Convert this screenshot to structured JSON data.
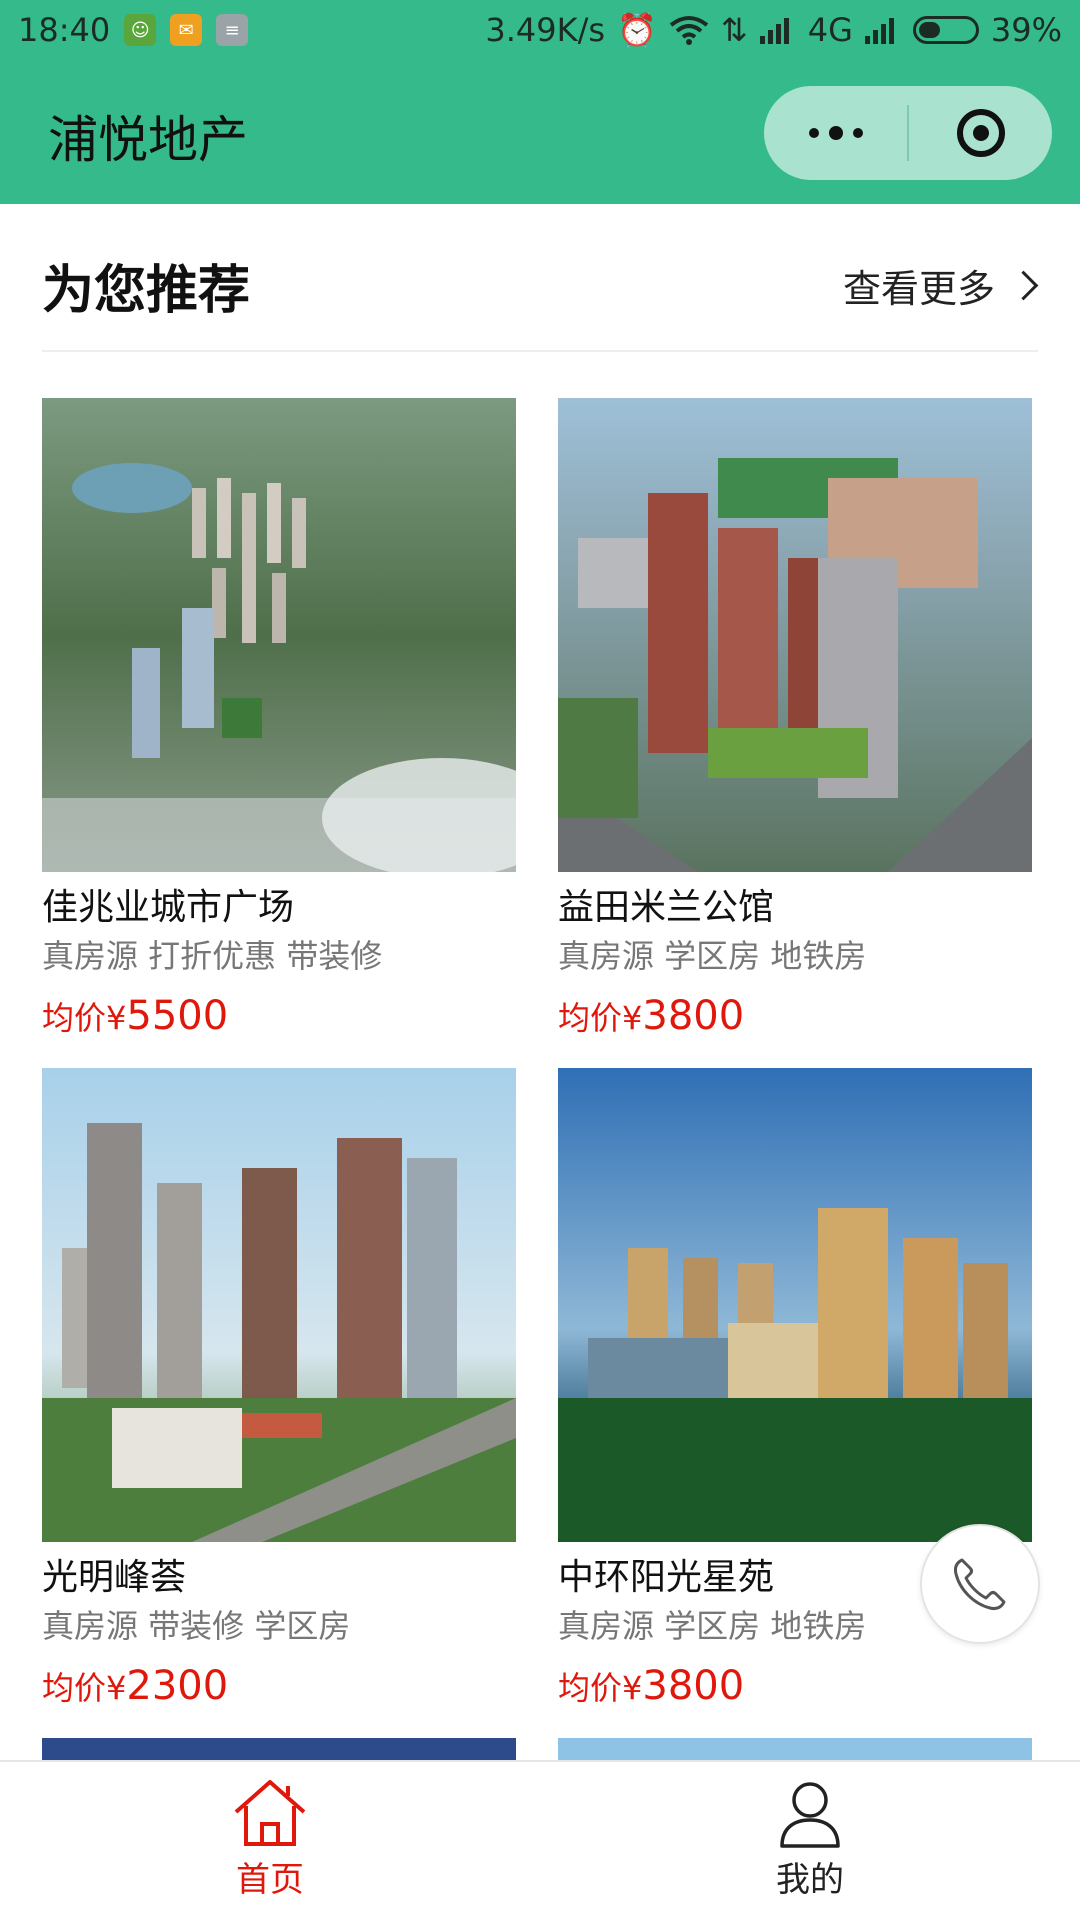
{
  "status_bar": {
    "time": "18:40",
    "speed": "3.49K/s",
    "network": "4G",
    "battery": "39%",
    "battery_level": 0.39
  },
  "header": {
    "title": "浦悦地产"
  },
  "section": {
    "title": "为您推荐",
    "more_label": "查看更多"
  },
  "listings": [
    {
      "name": "佳兆业城市广场",
      "tags": "真房源 打折优惠 带装修",
      "price_prefix": "均价¥",
      "price": "5500"
    },
    {
      "name": "益田米兰公馆",
      "tags": "真房源 学区房 地铁房",
      "price_prefix": "均价¥",
      "price": "3800"
    },
    {
      "name": "光明峰荟",
      "tags": "真房源 带装修 学区房",
      "price_prefix": "均价¥",
      "price": "2300"
    },
    {
      "name": "中环阳光星苑",
      "tags": "真房源 学区房 地铁房",
      "price_prefix": "均价¥",
      "price": "3800"
    }
  ],
  "tab_bar": {
    "tabs": [
      {
        "label": "首页",
        "icon": "home-icon",
        "active": true
      },
      {
        "label": "我的",
        "icon": "user-icon",
        "active": false
      }
    ]
  },
  "colors": {
    "brand_green": "#35bb8b",
    "price_red": "#e0180c"
  }
}
